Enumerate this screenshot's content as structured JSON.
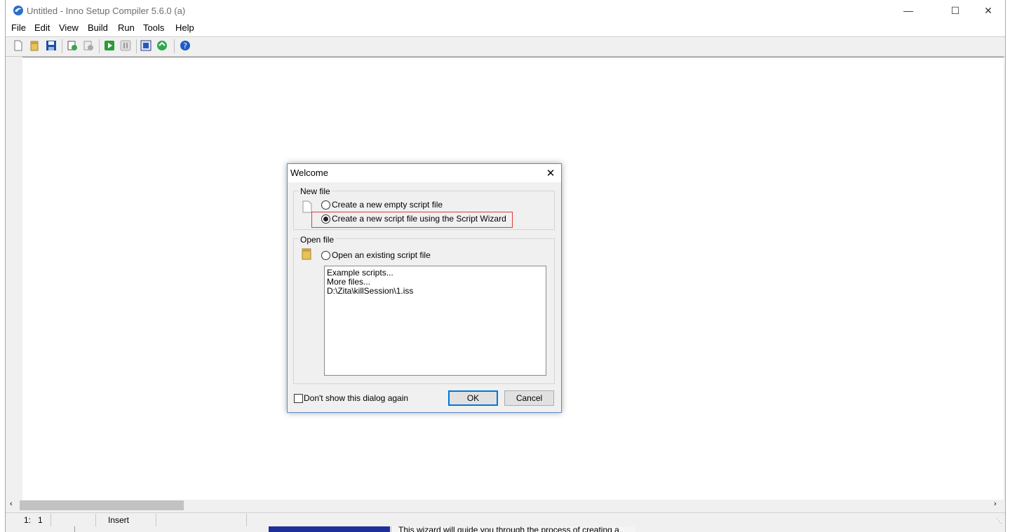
{
  "window": {
    "title": "Untitled - Inno Setup Compiler 5.6.0 (a)",
    "minimize_glyph": "—",
    "maximize_glyph": "☐",
    "close_glyph": "✕"
  },
  "menu": [
    "File",
    "Edit",
    "View",
    "Build",
    "Run",
    "Tools",
    "Help"
  ],
  "toolbar": {
    "icons": [
      "new-file-icon",
      "open-file-icon",
      "save-icon",
      "compile-icon",
      "stop-compile-icon",
      "run-icon",
      "pause-icon",
      "target-setup-icon",
      "target-uninstall-icon",
      "help-icon"
    ]
  },
  "status": {
    "position": "1:   1",
    "mode": "Insert"
  },
  "background_wizard": {
    "text": "This wizard will guide you through the process of creating a"
  },
  "dialog": {
    "title": "Welcome",
    "close_glyph": "✕",
    "new_file": {
      "label": "New file",
      "option_empty": "Create a new empty script file",
      "option_wizard": "Create a new script file using the Script Wizard",
      "selected": "wizard"
    },
    "open_file": {
      "label": "Open file",
      "option_existing": "Open an existing script file",
      "files": [
        "Example scripts...",
        "More files...",
        "D:\\Zita\\killSession\\1.iss"
      ]
    },
    "dont_show": "Don't show this dialog again",
    "ok": "OK",
    "cancel": "Cancel"
  },
  "colors": {
    "highlight_box": "#e0393e",
    "dialog_border": "#5b8ecf",
    "wizard_banner": "#1e2f9a"
  }
}
